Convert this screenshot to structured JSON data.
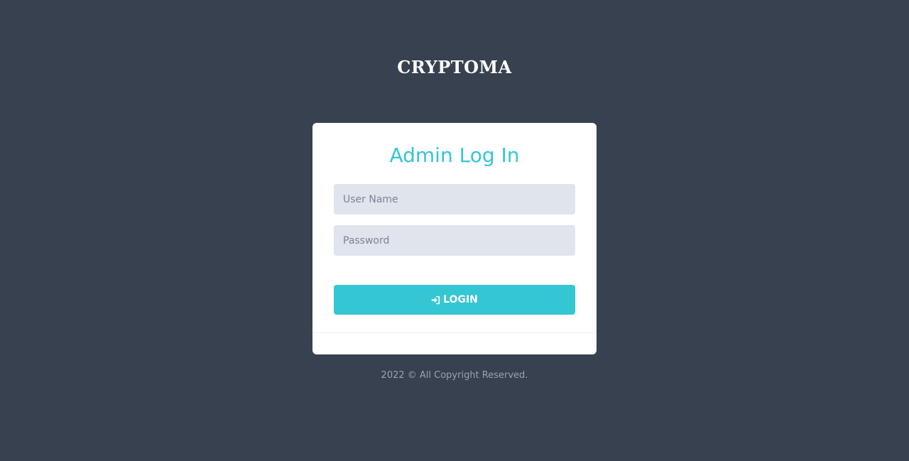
{
  "logo": {
    "text": "CRYPTOMA"
  },
  "login_card": {
    "title": "Admin Log In",
    "username": {
      "placeholder": "User Name",
      "value": ""
    },
    "password": {
      "placeholder": "Password",
      "value": ""
    },
    "login_button": {
      "label": "LOGIN",
      "icon": "sign-in-icon"
    }
  },
  "footer": {
    "text": "2022 © All Copyright Reserved."
  },
  "colors": {
    "background": "#37414f",
    "accent": "#35c6d3",
    "input_bg": "#dfe4ed",
    "card_bg": "#ffffff",
    "footer_text": "#9aa3b0"
  }
}
